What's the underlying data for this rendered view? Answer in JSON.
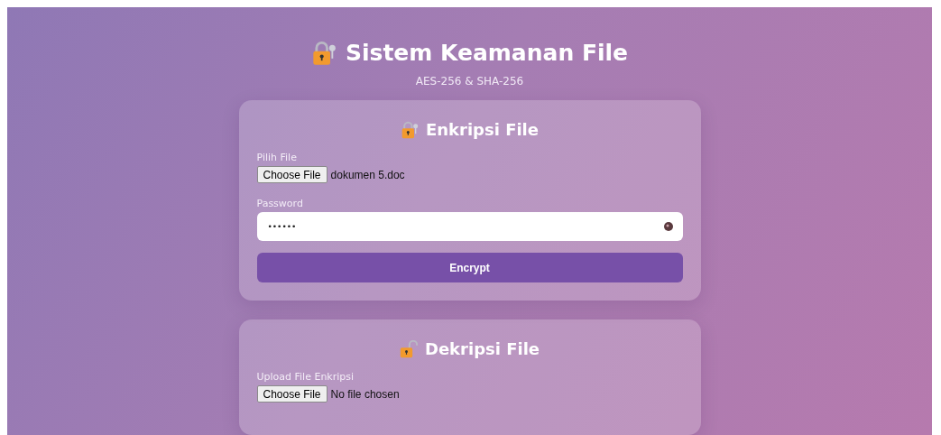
{
  "header": {
    "title": "Sistem Keamanan File",
    "subtitle": "AES-256 & SHA-256"
  },
  "cards": [
    {
      "kind": "encrypt",
      "title": "Enkripsi File",
      "file_label": "Pilih File",
      "file_button": "Choose File",
      "file_name": "dokumen 5.doc",
      "password_label": "Password",
      "password_value": "••••••",
      "action": "Encrypt"
    },
    {
      "kind": "decrypt",
      "title": "Dekripsi File",
      "file_label": "Upload File Enkripsi",
      "file_button": "Choose File",
      "file_name": "No file chosen"
    }
  ]
}
